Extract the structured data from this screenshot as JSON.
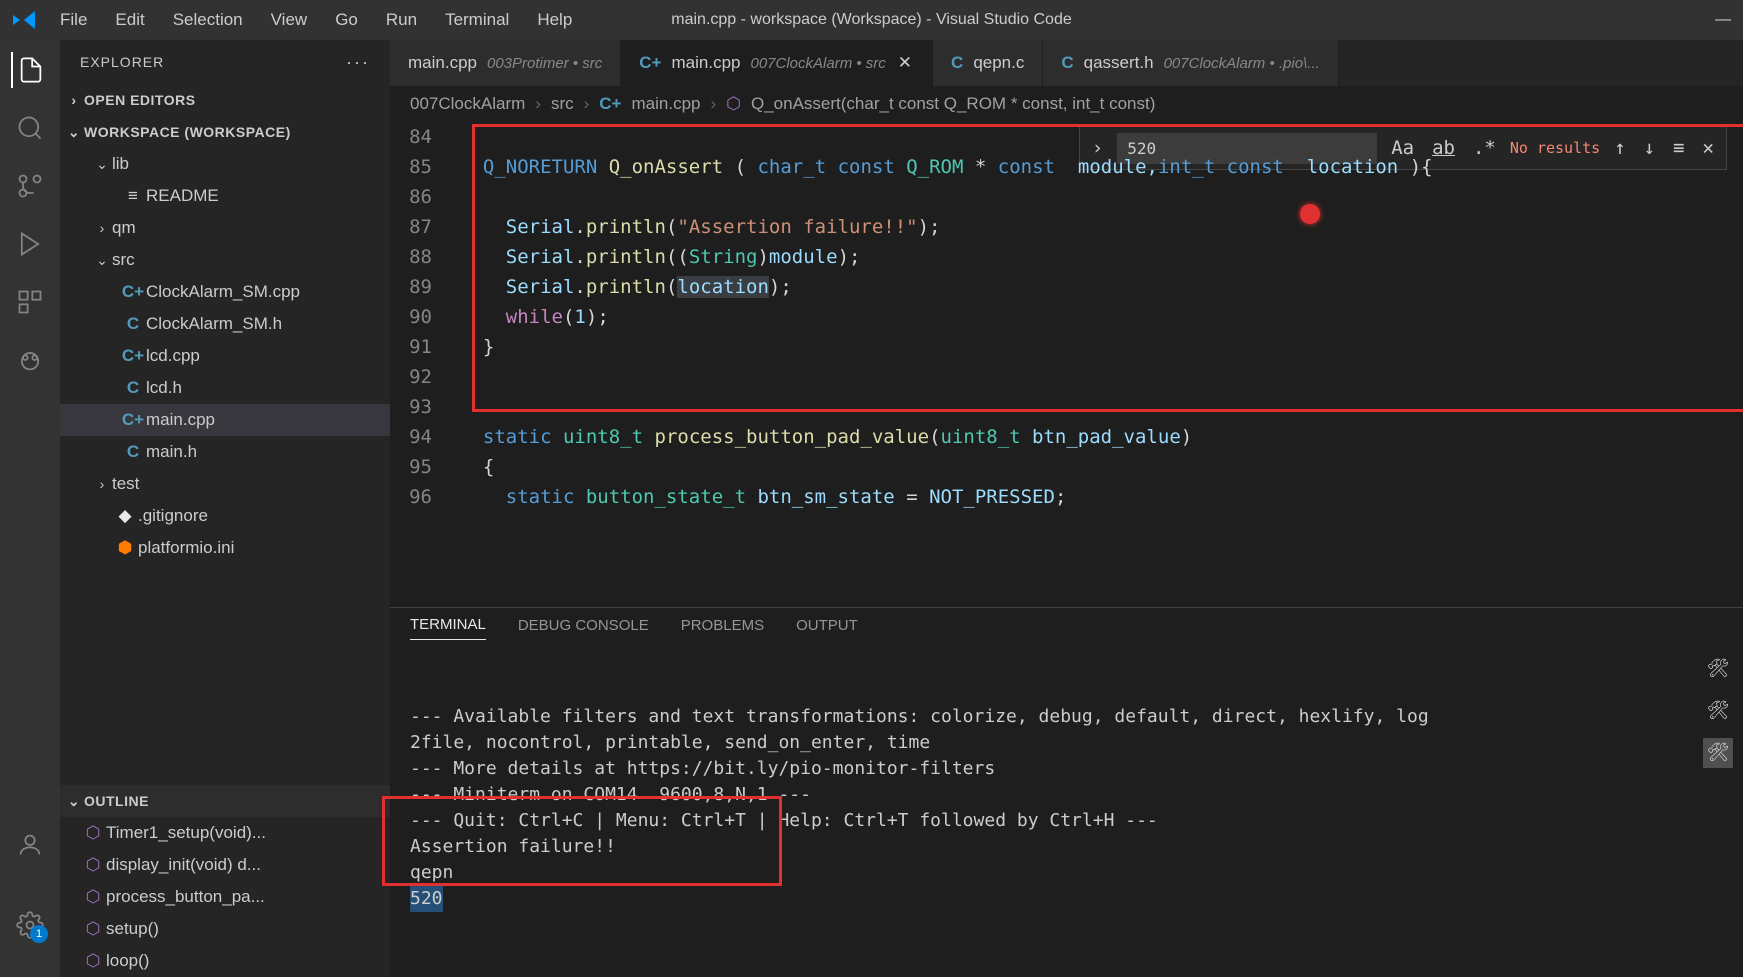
{
  "window": {
    "title": "main.cpp - workspace (Workspace) - Visual Studio Code"
  },
  "menu": {
    "file": "File",
    "edit": "Edit",
    "selection": "Selection",
    "view": "View",
    "go": "Go",
    "run": "Run",
    "terminal": "Terminal",
    "help": "Help"
  },
  "sidebar": {
    "title": "EXPLORER",
    "open_editors_label": "OPEN EDITORS",
    "workspace_label": "WORKSPACE (WORKSPACE)",
    "lib_label": "lib",
    "readme_label": "README",
    "qm_label": "qm",
    "src_label": "src",
    "files": {
      "clockalarm_cpp": "ClockAlarm_SM.cpp",
      "clockalarm_h": "ClockAlarm_SM.h",
      "lcd_cpp": "lcd.cpp",
      "lcd_h": "lcd.h",
      "main_cpp": "main.cpp",
      "main_h": "main.h"
    },
    "test_label": "test",
    "gitignore_label": ".gitignore",
    "platformio_label": "platformio.ini",
    "outline_label": "OUTLINE",
    "outline": {
      "timer1": "Timer1_setup(void)...",
      "display_init": "display_init(void)  d...",
      "process_button": "process_button_pa...",
      "setup": "setup()",
      "loop": "loop()"
    }
  },
  "tabs": {
    "tab1": {
      "name": "main.cpp",
      "path": "003Protimer • src"
    },
    "tab2": {
      "name": "main.cpp",
      "path": "007ClockAlarm • src"
    },
    "tab3": {
      "name": "qepn.c",
      "path": ""
    },
    "tab4": {
      "name": "qassert.h",
      "path": "007ClockAlarm • .pio\\..."
    }
  },
  "breadcrumb": {
    "p1": "007ClockAlarm",
    "p2": "src",
    "p3": "main.cpp",
    "p4": "Q_onAssert(char_t const Q_ROM * const, int_t const)"
  },
  "code": {
    "ln84": "84",
    "ln85": "85",
    "ln86": "86",
    "ln87": "87",
    "ln88": "88",
    "ln89": "89",
    "ln90": "90",
    "ln91": "91",
    "ln92": "92",
    "ln93": "93",
    "ln94": "94",
    "ln95": "95",
    "ln96": "96",
    "l85_noreturn": "Q_NORETURN",
    "l85_fn": "Q_onAssert",
    "l85_char_t": "char_t",
    "l85_const": "const",
    "l85_qrom": "Q_ROM",
    "l85_module": "module,",
    "l85_intt": "int_t",
    "l85_location": "location",
    "l87_serial": "Serial",
    "l87_println": "println",
    "l87_str": "\"Assertion failure!!\"",
    "l88_string": "String",
    "l88_module": "module",
    "l89_location": "location",
    "l90_while": "while",
    "l90_one": "1",
    "l94_static": "static",
    "l94_uint8": "uint8_t",
    "l94_fn": "process_button_pad_value",
    "l94_arg": "btn_pad_value",
    "l96_static": "static",
    "l96_type": "button_state_t",
    "l96_var": "btn_sm_state",
    "l96_val": "NOT_PRESSED"
  },
  "find": {
    "value": "520",
    "results": "No results"
  },
  "panel": {
    "terminal": "TERMINAL",
    "debug": "DEBUG CONSOLE",
    "problems": "PROBLEMS",
    "output": "OUTPUT"
  },
  "terminal": {
    "l1": "--- Available filters and text transformations: colorize, debug, default, direct, hexlify, log",
    "l2": "2file, nocontrol, printable, send_on_enter, time",
    "l3": "--- More details at https://bit.ly/pio-monitor-filters",
    "l4": "--- Miniterm on COM14  9600,8,N,1 ---",
    "l5": "--- Quit: Ctrl+C | Menu: Ctrl+T | Help: Ctrl+T followed by Ctrl+H ---",
    "l6": "Assertion failure!!",
    "l7": "qepn",
    "l8": "520"
  },
  "settings_badge": "1"
}
